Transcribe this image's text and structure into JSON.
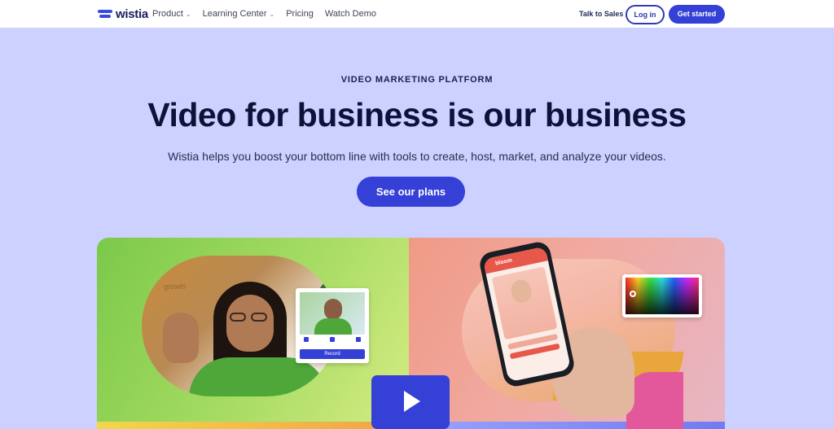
{
  "nav": {
    "logo": "wistia",
    "items": [
      {
        "label": "Product",
        "has_dropdown": true
      },
      {
        "label": "Learning Center",
        "has_dropdown": true
      },
      {
        "label": "Pricing",
        "has_dropdown": false
      },
      {
        "label": "Watch Demo",
        "has_dropdown": false
      }
    ],
    "talk_to_sales": "Talk to Sales",
    "login": "Log in",
    "get_started": "Get started"
  },
  "hero": {
    "eyebrow": "VIDEO MARKETING PLATFORM",
    "headline": "Video for business is our business",
    "subtitle": "Wistia helps you boost your bottom line with tools to create, host, market, and analyze your videos.",
    "cta": "See our plans"
  },
  "media": {
    "wall_text": "growth",
    "record_button": "Record",
    "phone_brand": "bloom",
    "play_icon": "play-icon"
  },
  "colors": {
    "accent": "#3440d6",
    "background": "#ccd1ff",
    "headline": "#0c1238"
  }
}
